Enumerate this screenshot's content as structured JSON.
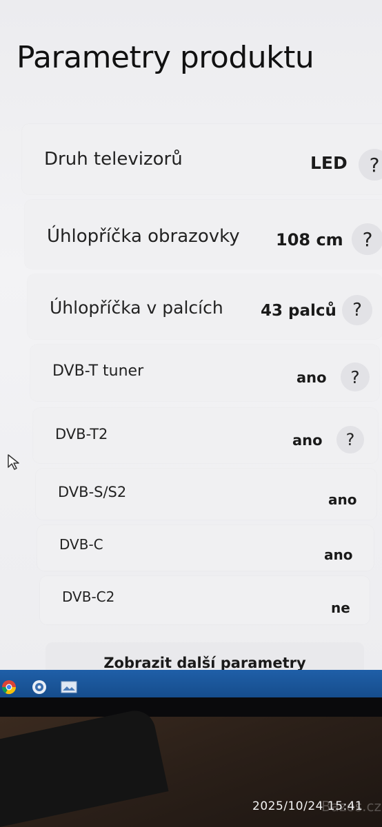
{
  "page": {
    "title": "Parametry produktu"
  },
  "parameters": [
    {
      "label": "Druh televizorů",
      "value": "LED",
      "has_help": true
    },
    {
      "label": "Úhlopříčka obrazovky",
      "value": "108 cm",
      "has_help": true
    },
    {
      "label": "Úhlopříčka v palcích",
      "value": "43 palců",
      "has_help": true
    },
    {
      "label": "DVB-T tuner",
      "value": "ano",
      "has_help": true
    },
    {
      "label": "DVB-T2",
      "value": "ano",
      "has_help": true
    },
    {
      "label": "DVB-S/S2",
      "value": "ano",
      "has_help": false
    },
    {
      "label": "DVB-C",
      "value": "ano",
      "has_help": false
    },
    {
      "label": "DVB-C2",
      "value": "ne",
      "has_help": false
    }
  ],
  "help_symbol": "?",
  "more_button": {
    "label": "Zobrazit další parametry"
  },
  "taskbar": {
    "icons": [
      "chrome-icon",
      "firefox-icon",
      "image-viewer-icon"
    ]
  },
  "photo": {
    "timestamp": "2025/10/24 15:41",
    "watermark": "Bazos.cz"
  }
}
